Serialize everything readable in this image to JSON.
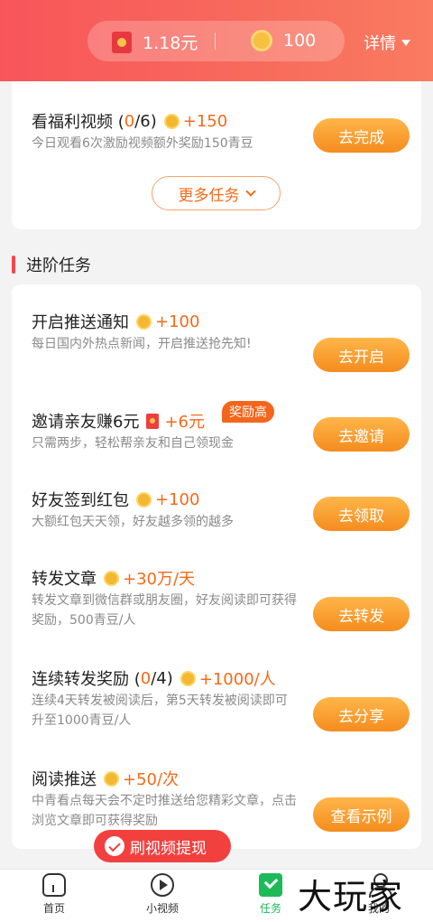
{
  "header": {
    "cash_value": "1.18元",
    "coin_value": "100",
    "details_label": "详情",
    "icons": {
      "cash": "red-envelope-icon",
      "coin": "gold-coin-icon",
      "details": "caret-down-icon"
    }
  },
  "welfare_card": {
    "title": "看福利视频 (",
    "progress_current": "0",
    "progress_total": " /6)",
    "reward": "+150",
    "desc": "今日观看6次激励视频额外奖励150青豆",
    "button": "去完成",
    "more_button": "更多任务"
  },
  "section": {
    "title": "进阶任务"
  },
  "tasks": [
    {
      "title": "开启推送通知",
      "reward": "+100",
      "desc": "每日国内外热点新闻，开启推送抢先知!",
      "button": "去开启"
    },
    {
      "title": "邀请亲友赚6元",
      "reward": "+6元",
      "badge": "奖励高",
      "desc": "只需两步，轻松帮亲友和自己领现金",
      "button": "去邀请"
    },
    {
      "title": "好友签到红包",
      "reward": "+100",
      "desc": "大额红包天天领，好友越多领的越多",
      "button": "去领取"
    },
    {
      "title": "转发文章",
      "reward": "+30万/天",
      "desc": "转发文章到微信群或朋友圈，好友阅读即可获得奖励，500青豆/人",
      "button": "去转发"
    },
    {
      "title": "连续转发奖励 (",
      "progress_current": "0",
      "progress_total": " /4)",
      "reward": "+1000/人",
      "desc": "连续4天转发被阅读后，第5天转发被阅读即可升至1000青豆/人",
      "button": "去分享"
    },
    {
      "title": "阅读推送",
      "reward": "+50/次",
      "desc": "中青看点每天会不定时推送给您精彩文章，点击浏览文章即可获得奖励",
      "button": "查看示例"
    }
  ],
  "floating": {
    "label": "刷视频提现"
  },
  "bottom_nav": {
    "items": [
      {
        "label": "首页",
        "icon": "home-icon"
      },
      {
        "label": "小视频",
        "icon": "play-icon"
      },
      {
        "label": "任务",
        "icon": "task-check-icon"
      },
      {
        "label": "我的",
        "icon": "profile-icon"
      }
    ]
  },
  "watermark": "大玩家",
  "colors": {
    "accent": "#f56a18",
    "header_red": "#f8555a",
    "active_green": "#1dba5a"
  }
}
